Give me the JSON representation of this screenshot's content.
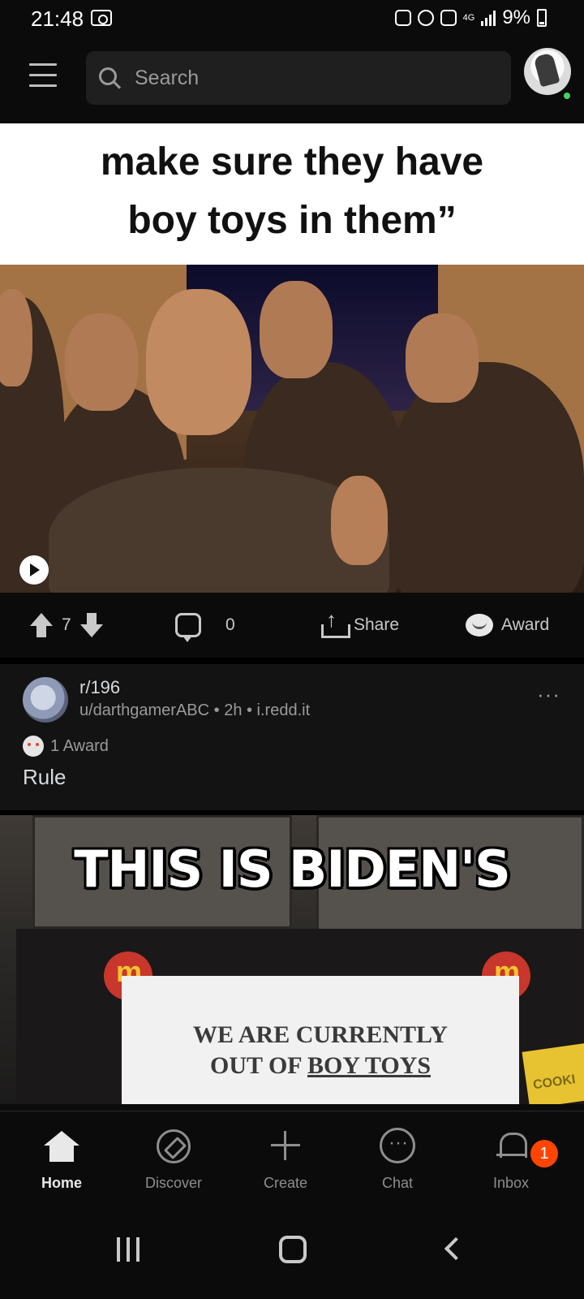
{
  "status_bar": {
    "time": "21:48",
    "network": "4G",
    "battery": "9%"
  },
  "header": {
    "search_placeholder": "Search"
  },
  "post1": {
    "meme_caption_line1": "make sure they have",
    "meme_caption_line2": "boy toys in them”",
    "vote_count": "7",
    "comment_count": "0",
    "share_label": "Share",
    "award_label": "Award"
  },
  "post2": {
    "subreddit": "r/196",
    "meta": "u/darthgamerABC • 2h • i.redd.it",
    "awards": "1 Award",
    "title": "Rule",
    "image_text_top": "THIS IS BIDEN'S",
    "sign_line1": "WE ARE CURRENTLY",
    "sign_line2_prefix": "OUT OF ",
    "sign_line2_underlined": "BOY TOYS"
  },
  "bottom_nav": {
    "items": [
      {
        "label": "Home"
      },
      {
        "label": "Discover"
      },
      {
        "label": "Create"
      },
      {
        "label": "Chat"
      },
      {
        "label": "Inbox"
      }
    ],
    "inbox_badge": "1"
  },
  "colors": {
    "background": "#0b0b0b",
    "card": "#131313",
    "accent_badge": "#ff4500",
    "online_dot": "#46d160"
  }
}
